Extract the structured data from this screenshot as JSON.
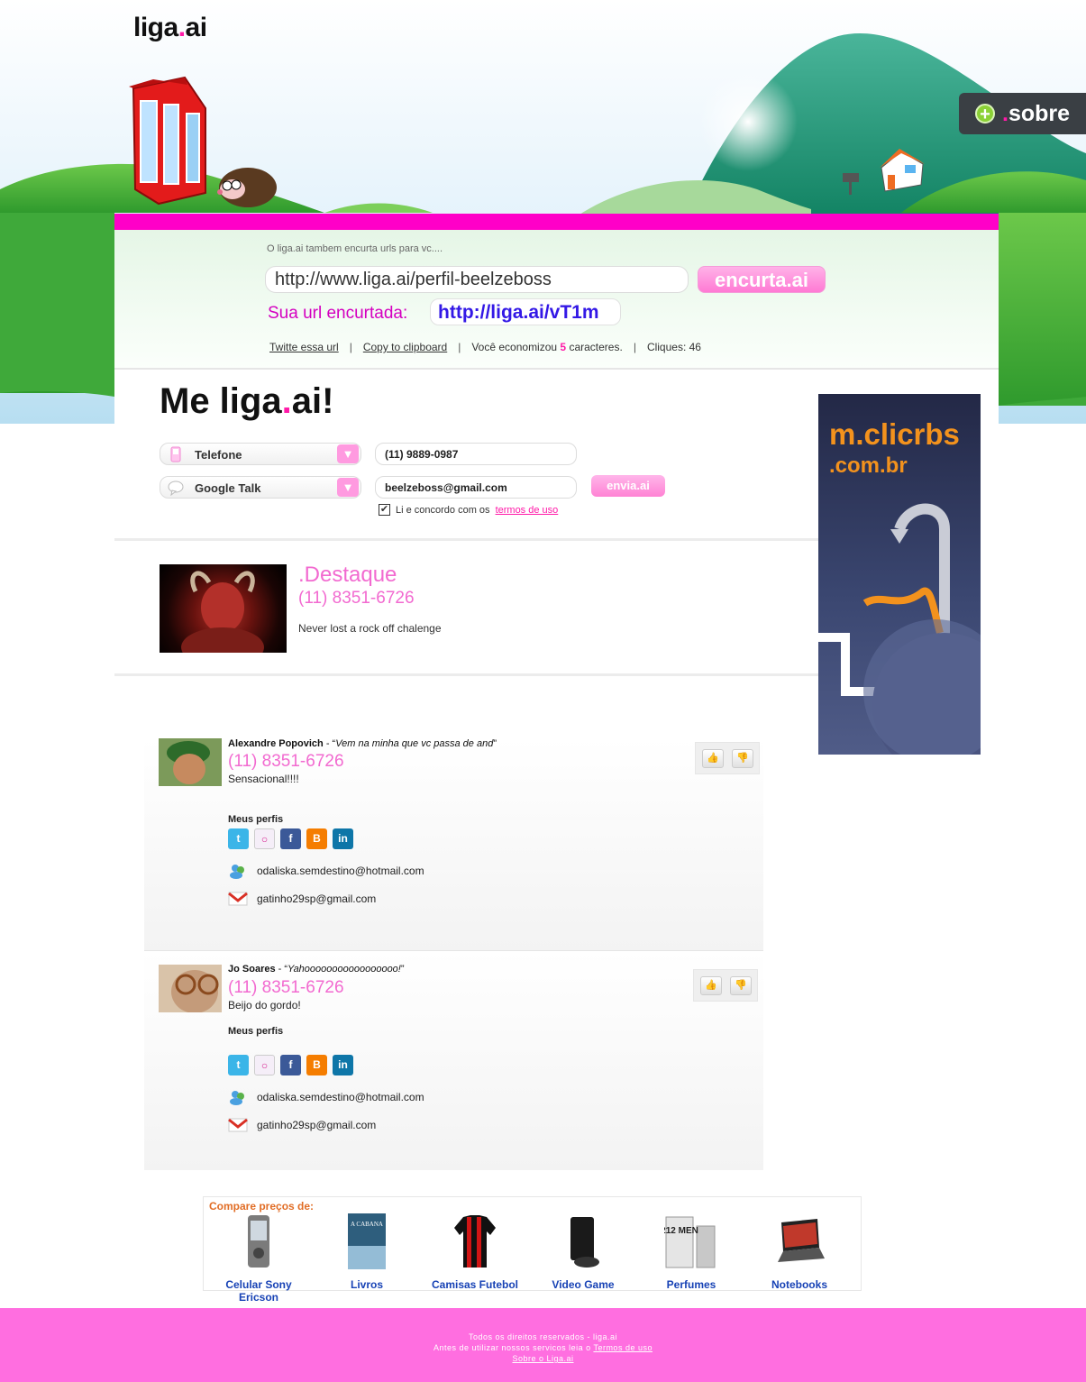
{
  "brand": {
    "name_left": "liga",
    "name_dot": ".",
    "name_right": "ai"
  },
  "colors": {
    "accent_pink": "#ff1aa8",
    "bar_pink": "#ff00c8",
    "link_blue": "#1742b5",
    "footer_pink": "#ff6ee0"
  },
  "header": {
    "sobre_dot": ".",
    "sobre_label": "sobre"
  },
  "shortener": {
    "hint": "O liga.ai tambem encurta urls para vc....",
    "url_value": "http://www.liga.ai/perfil-beelzeboss",
    "button": "encurta.ai",
    "result_label": "Sua url encurtada:",
    "result_url": "http://liga.ai/vT1m",
    "tweet_link": "Twitte essa url",
    "copy_link": "Copy to clipboard",
    "saved_prefix": "Você economizou",
    "saved_count": "5",
    "saved_suffix": "caracteres.",
    "clicks": "Cliques: 46"
  },
  "form": {
    "title_left": "Me liga",
    "title_dot": ".",
    "title_right": "ai!",
    "select1": "Telefone",
    "value1": "(11) 9889-0987",
    "select2": "Google Talk",
    "value2": "beelzeboss@gmail.com",
    "submit": "envia.ai",
    "agree_text": "Li e concordo com os",
    "terms_link": "termos de uso"
  },
  "featured": {
    "title": ".Destaque",
    "phone": "(11) 8351-6726",
    "text": "Never lost a rock off chalenge"
  },
  "ad": {
    "line1": "m.clicrbs",
    "line2": ".com.br"
  },
  "posts": [
    {
      "name": "Alexandre Popovich",
      "sep": " - “",
      "quote": "Vem na minha que vc passa de and",
      "endquote": "”",
      "phone": "(11) 8351-6726",
      "message": "Sensacional!!!!",
      "profiles_label": "Meus perfis",
      "msn": "odaliska.semdestino@hotmail.com",
      "gmail": "gatinho29sp@gmail.com"
    },
    {
      "name": "Jo Soares",
      "sep": " - “",
      "quote": "Yahooooooooooooooooo!",
      "endquote": "”",
      "phone": "(11) 8351-6726",
      "message": "Beijo do gordo!",
      "profiles_label": "Meus perfis",
      "msn": "odaliska.semdestino@hotmail.com",
      "gmail": "gatinho29sp@gmail.com"
    }
  ],
  "social_icons": [
    "twitter-icon",
    "flickr-icon",
    "facebook-icon",
    "blogger-icon",
    "linkedin-icon"
  ],
  "compare": {
    "title": "Compare preços de:",
    "products": [
      "Celular Sony Ericson",
      "Livros",
      "Camisas Futebol",
      "Video Game",
      "Perfumes",
      "Notebooks"
    ],
    "book_text": "A CABANA",
    "perfume_text": "212 MEN"
  },
  "footer": {
    "line1": "Todos os direitos reservados - liga.ai",
    "line2_prefix": "Antes de utilizar nossos servicos leia o",
    "line2_link": "Termos de uso",
    "line3": "Sobre o Liga.ai"
  }
}
